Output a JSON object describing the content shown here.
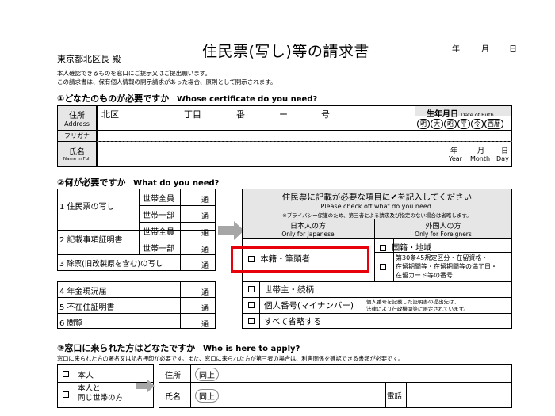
{
  "header": {
    "addressee": "東京都北区長 殿",
    "title": "住民票(写し)等の請求書",
    "date_year": "年",
    "date_month": "月",
    "date_day": "日",
    "intro1": "本人確認できるものを窓口にご提示又はご提出願います。",
    "intro2": "この請求書は、保有個人情報の開示請求があった場合、原則として開示されます。"
  },
  "s1": {
    "heading": "①どなたのものが必要ですか",
    "heading_en": "Whose certificate do you need?",
    "addr_label": "住所",
    "addr_label_en": "Address",
    "addr_ward": "北区",
    "chome": "丁目",
    "ban": "番",
    "dash": "ー",
    "go": "号",
    "dob_label": "生年月日",
    "dob_en": "Date of Birth",
    "eras": [
      "明",
      "大",
      "昭",
      "平",
      "令",
      "西暦"
    ],
    "furigana": "フリガナ",
    "name_label": "氏名",
    "name_en": "Name in Full",
    "y": "年",
    "m": "月",
    "d": "日",
    "y_en": "Year",
    "m_en": "Month",
    "d_en": "Day"
  },
  "s2": {
    "heading": "②何が必要ですか",
    "heading_en": "What do you need?",
    "items": [
      {
        "label": "1 住民票の写し",
        "sub": [
          "世帯全員",
          "世帯一部"
        ]
      },
      {
        "label": "2 記載事項証明書",
        "sub": [
          "世帯全員",
          "世帯一部"
        ]
      },
      {
        "label": "3 除票(旧改製原を含む)の写し"
      },
      {
        "label": "4 年金現況届"
      },
      {
        "label": "5 不在住証明書"
      },
      {
        "label": "6 閲覧"
      }
    ],
    "tsu": "通",
    "check_title": "住民票に記載が必要な項目に✔を記入してください",
    "check_en": "Please check off what do you need.",
    "check_note": "※プライバシー保護のため、第三者による請求及び指定のない場合は省略します。",
    "jp_col": "日本人の方",
    "jp_col_en": "Only for Japanese",
    "fr_col": "外国人の方",
    "fr_col_en": "Only for Foreigners",
    "honseki": "本籍・筆頭者",
    "kokuseki": "国籍・地域",
    "foreign_note": [
      "第30条45規定区分・在留資格・",
      "在留期間等・在留期間等の満了日・",
      "在留カード等の番号"
    ],
    "setainushi": "世帯主・続柄",
    "kojin": "個人番号(マイナンバー)",
    "kojin_note": [
      "個人番号を記載した証明書の提出先は、",
      "法律により行政機関等に限定されています。"
    ],
    "omit": "すべて省略する"
  },
  "s3": {
    "heading": "③窓口に来られた方はどなたですか",
    "heading_en": "Who is here to apply?",
    "note": "窓口に来られた方の署名又は記名押印が必要です。また、窓口に来られた方が第三者の場合は、利害関係を確認できる書類が必要です。",
    "self": "本人",
    "same_house1": "本人と",
    "same_house2": "同じ世帯の方",
    "addr": "住所",
    "same_above": "同上",
    "name": "氏名",
    "phone": "電話"
  },
  "colors": {
    "highlight": "#e8000b",
    "header_gray": "#e6e6e6",
    "arrow": "#a6a6a6"
  }
}
